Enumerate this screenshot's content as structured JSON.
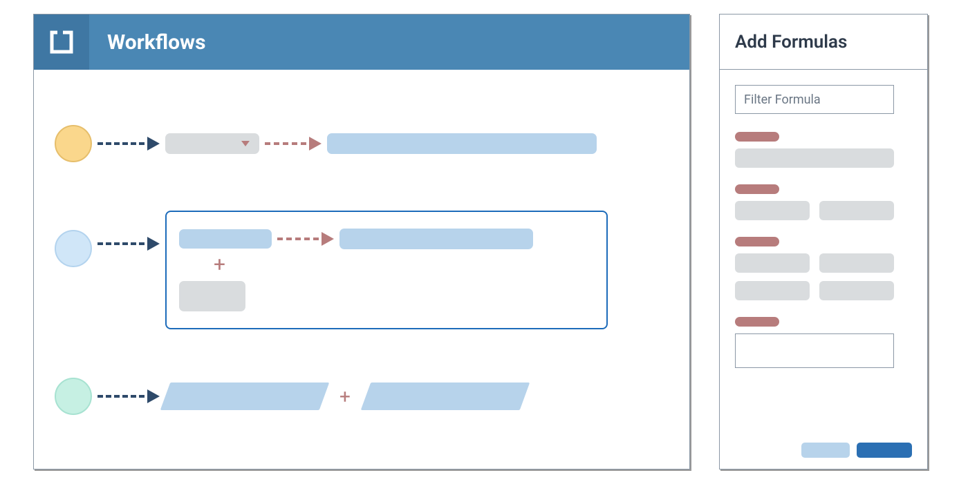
{
  "main": {
    "title": "Workflows"
  },
  "sidepanel": {
    "title": "Add Formulas",
    "filter_placeholder": "Filter Formula"
  }
}
